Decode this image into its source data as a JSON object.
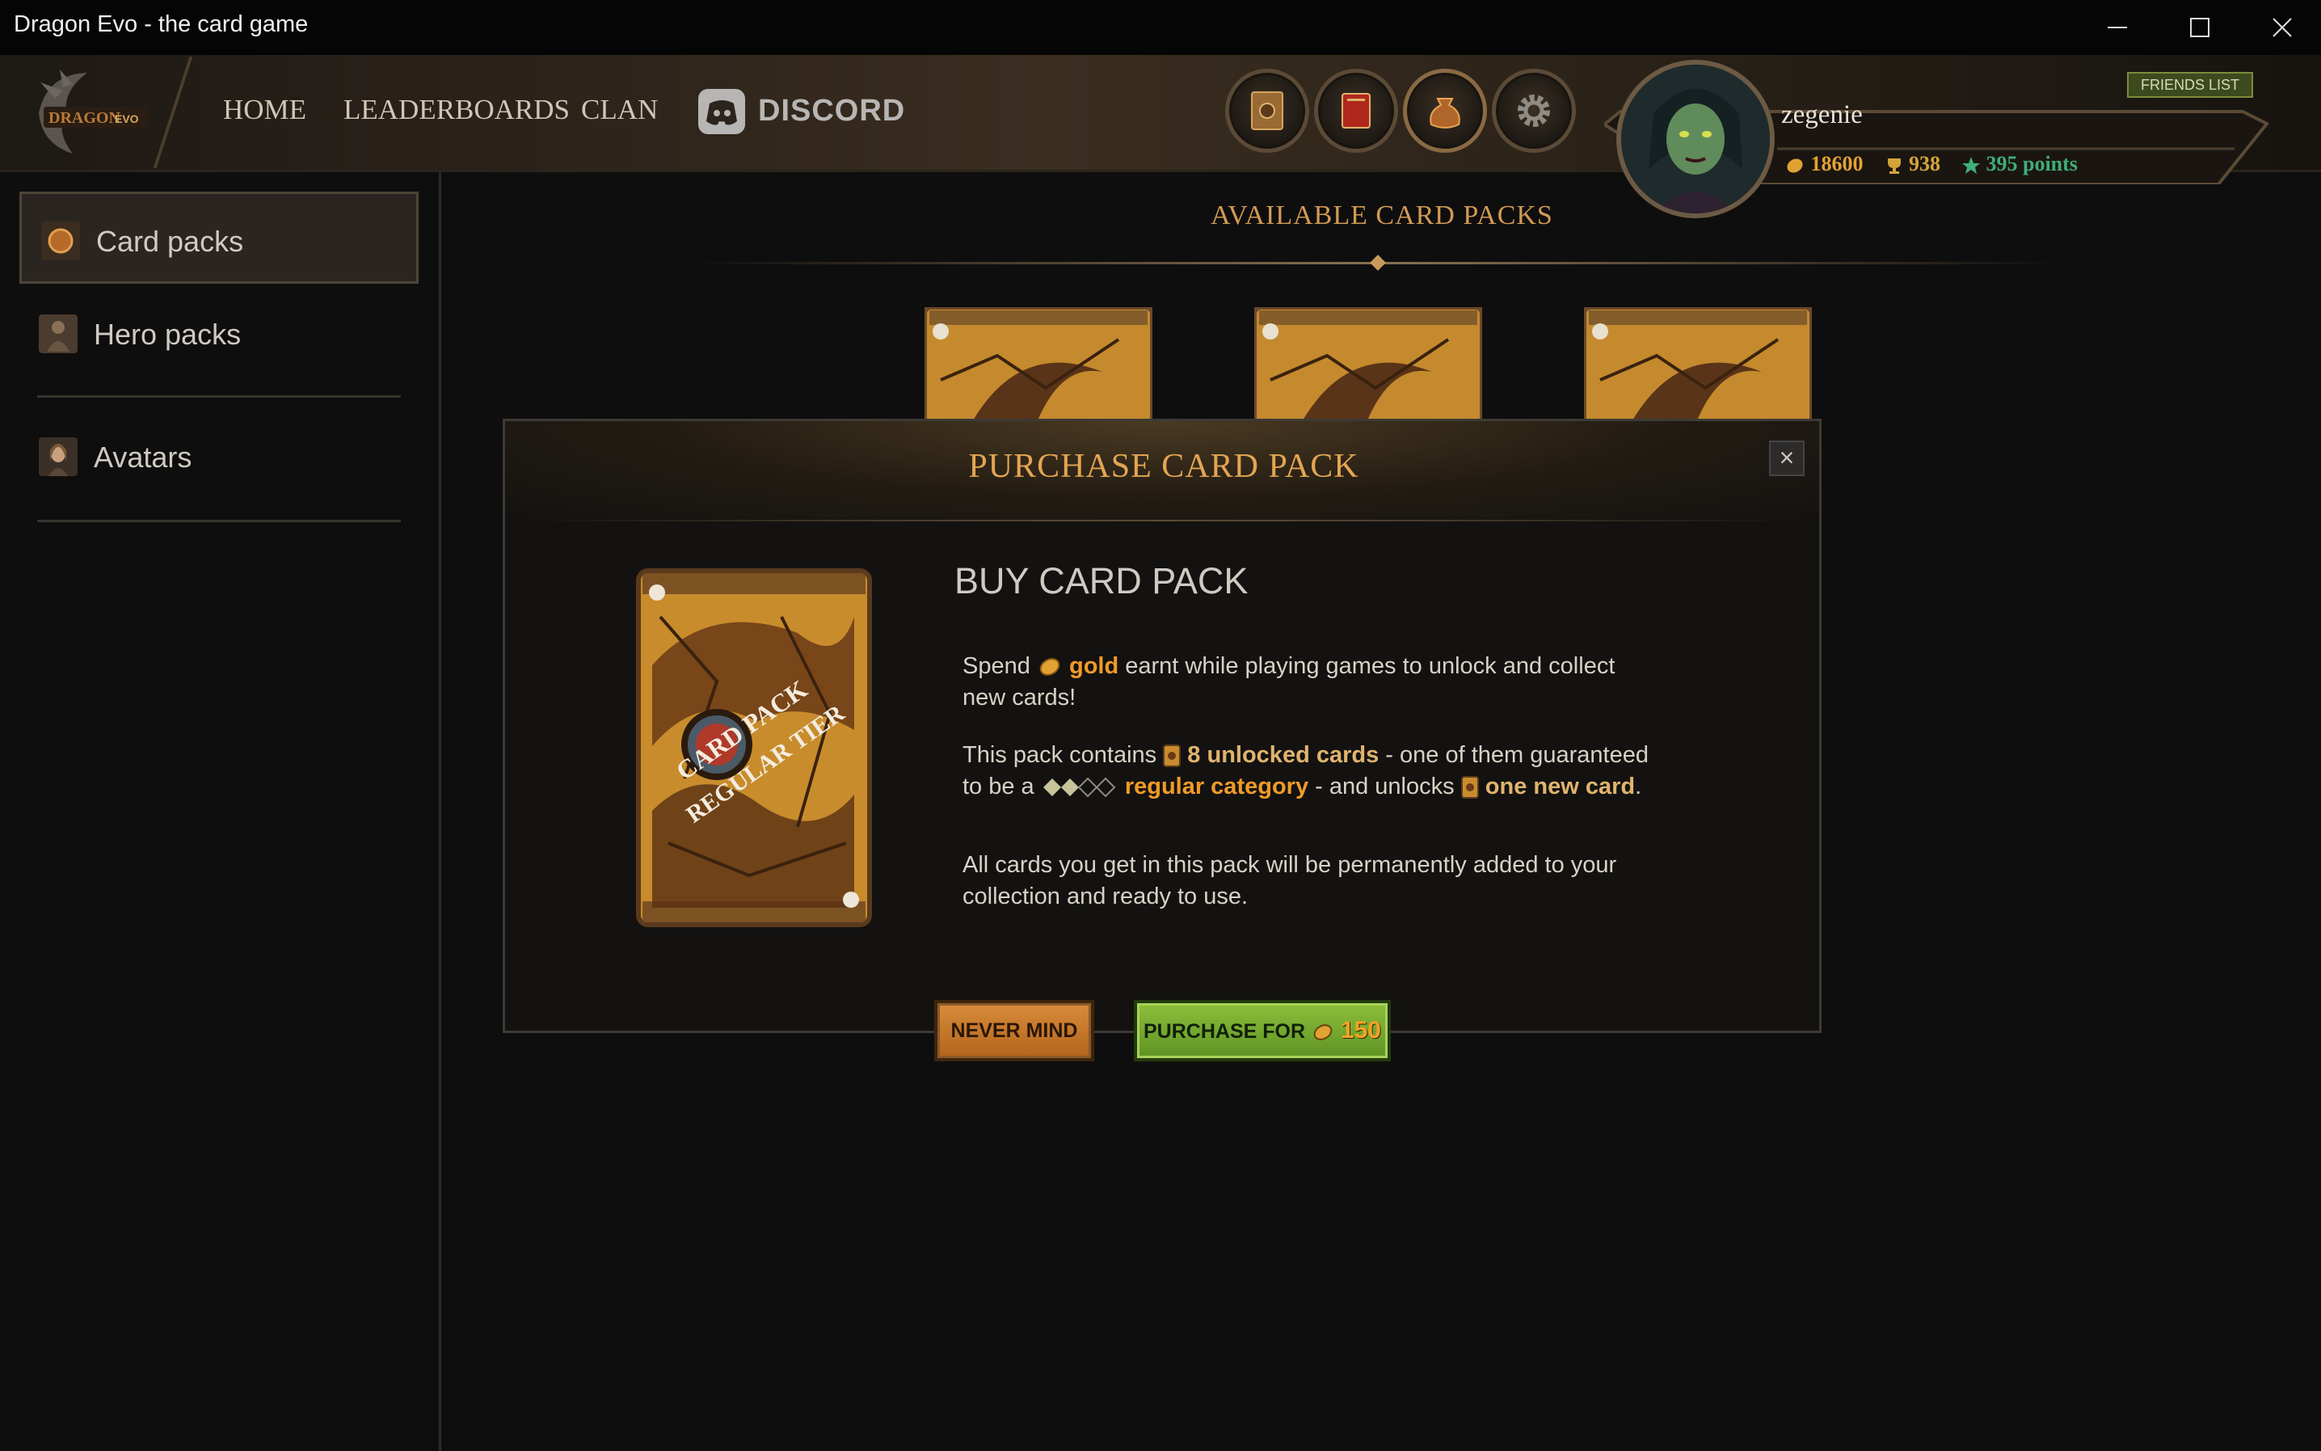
{
  "window": {
    "title": "Dragon Evo - the card game"
  },
  "nav": {
    "logo_text": "DRAGON EVO",
    "links": [
      "HOME",
      "LEADERBOARDS",
      "CLAN"
    ],
    "discord_label": "DISCORD",
    "round_buttons": [
      "card-book-icon",
      "red-book-icon",
      "coin-bag-icon",
      "gear-icon"
    ]
  },
  "profile": {
    "username": "zegenie",
    "gold": "18600",
    "trophies": "938",
    "points": "395 points",
    "friends_label": "FRIENDS LIST"
  },
  "sidebar": {
    "items": [
      {
        "label": "Card packs"
      },
      {
        "label": "Hero packs"
      },
      {
        "label": "Avatars"
      }
    ]
  },
  "main": {
    "section_title": "AVAILABLE CARD PACKS"
  },
  "modal": {
    "title": "PURCHASE CARD PACK",
    "close_glyph": "×",
    "pack_line1": "CARD PACK",
    "pack_line2": "REGULAR TIER",
    "heading": "BUY CARD PACK",
    "p1_a": "Spend",
    "p1_gold": "gold",
    "p1_b": "earnt while playing games to unlock and collect new cards!",
    "p2_a": "This pack contains",
    "p2_cards": "8 unlocked cards",
    "p2_b": "- one of them guaranteed to be a",
    "p2_cat": "regular category",
    "p2_c": "- and unlocks",
    "p2_new": "one new card",
    "p2_d": ".",
    "p3": "All cards you get in this pack will be permanently added to your collection and ready to use."
  },
  "buttons": {
    "never_mind": "NEVER MIND",
    "purchase_for": "PURCHASE FOR",
    "price": "150"
  },
  "colors": {
    "accent_gold": "#e3a552",
    "gold_text": "#f09a28",
    "points_green": "#3fae7a",
    "purchase_green": "#7aab30",
    "never_orange": "#c97a2c"
  }
}
